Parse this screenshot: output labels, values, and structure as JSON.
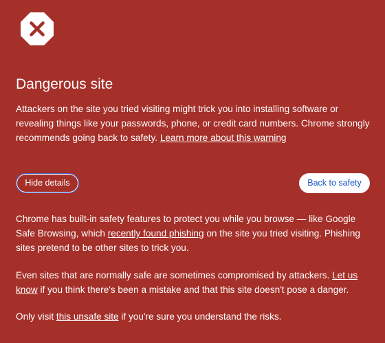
{
  "icon": "close-x-octagon-icon",
  "colors": {
    "background": "#A52F29",
    "icon_mark": "#A52F29",
    "primary_button_text": "#1A5AC8",
    "focus_ring": "#3F6FE0"
  },
  "title": "Dangerous site",
  "intro": {
    "text": "Attackers on the site you tried visiting might trick you into installing software or revealing things like your passwords, phone, or credit card numbers. Chrome strongly recommends going back to safety. ",
    "link": "Learn more about this warning"
  },
  "buttons": {
    "hide_details": "Hide details",
    "back_to_safety": "Back to safety"
  },
  "details": {
    "p1_before": "Chrome has built-in safety features to protect you while you browse — like Google Safe Browsing, which ",
    "p1_link": "recently found phishing",
    "p1_after": " on the site you tried visiting. Phishing sites pretend to be other sites to trick you.",
    "p2_before": "Even sites that are normally safe are sometimes compromised by attackers. ",
    "p2_link": "Let us know",
    "p2_after": " if you think there's been a mistake and that this site doesn't pose a danger.",
    "p3_before": "Only visit ",
    "p3_link": "this unsafe site",
    "p3_after": " if you're sure you understand the risks."
  }
}
